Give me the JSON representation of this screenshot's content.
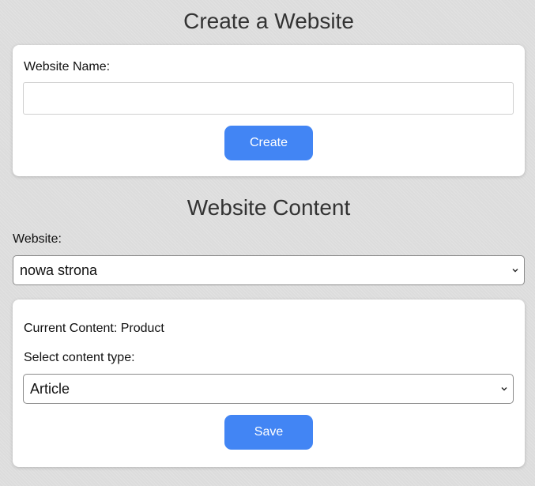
{
  "create_section": {
    "title": "Create a Website",
    "name_label": "Website Name:",
    "name_value": "",
    "name_placeholder": "",
    "create_button": "Create"
  },
  "content_section": {
    "title": "Website Content",
    "website_label": "Website:",
    "website_selected": "nowa strona",
    "current_content_text": "Current Content: Product",
    "content_type_label": "Select content type:",
    "content_type_selected": "Article",
    "save_button": "Save"
  },
  "colors": {
    "accent": "#4285f4",
    "card_background": "#ffffff",
    "page_background": "#dcdcdc"
  },
  "icons": {
    "select_arrow": "chevron-down-icon"
  }
}
